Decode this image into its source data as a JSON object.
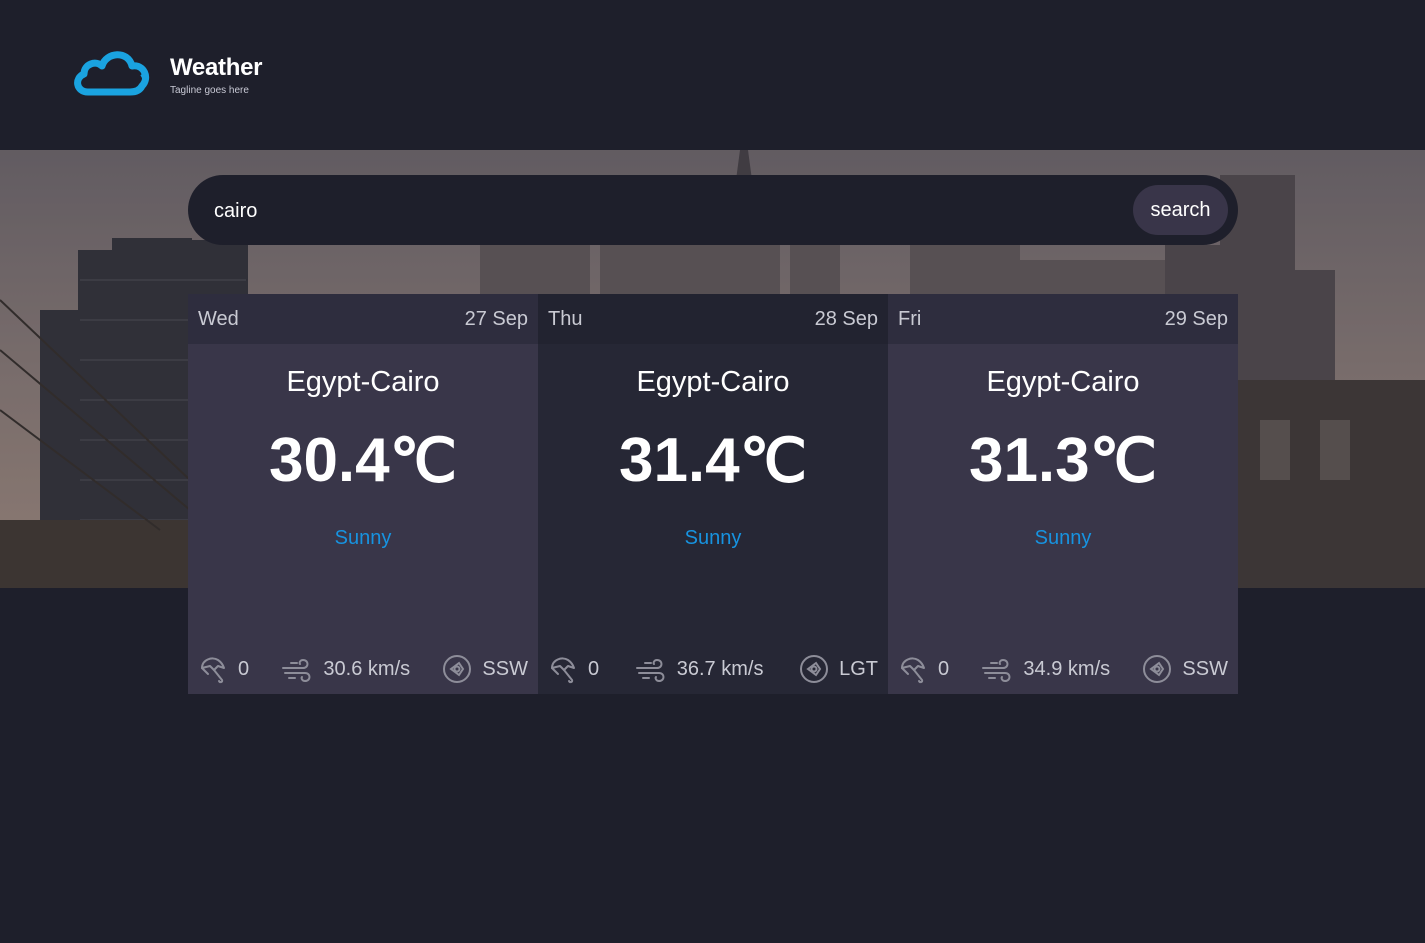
{
  "brand": {
    "title": "Weather",
    "tagline": "Tagline goes here",
    "logo_icon": "cloud-icon",
    "accent": "#1aa3e0"
  },
  "search": {
    "value": "cairo",
    "button_label": "search"
  },
  "forecast": [
    {
      "day": "Wed",
      "date": "27 Sep",
      "location": "Egypt-Cairo",
      "temp": "30.4",
      "unit": "℃",
      "condition": "Sunny",
      "precip": "0",
      "wind": "30.6  km/s",
      "direction": "SSW"
    },
    {
      "day": "Thu",
      "date": "28 Sep",
      "location": "Egypt-Cairo",
      "temp": "31.4",
      "unit": "℃",
      "condition": "Sunny",
      "precip": "0",
      "wind": "36.7  km/s",
      "direction": "LGT"
    },
    {
      "day": "Fri",
      "date": "29 Sep",
      "location": "Egypt-Cairo",
      "temp": "31.3",
      "unit": "℃",
      "condition": "Sunny",
      "precip": "0",
      "wind": "34.9  km/s",
      "direction": "SSW"
    }
  ],
  "icons": {
    "precip": "umbrella-icon",
    "wind": "wind-icon",
    "direction": "compass-icon"
  },
  "colors": {
    "background": "#1e1f2b",
    "condition": "#1793e0",
    "card_light": "#393649",
    "card_dark": "#262735"
  }
}
